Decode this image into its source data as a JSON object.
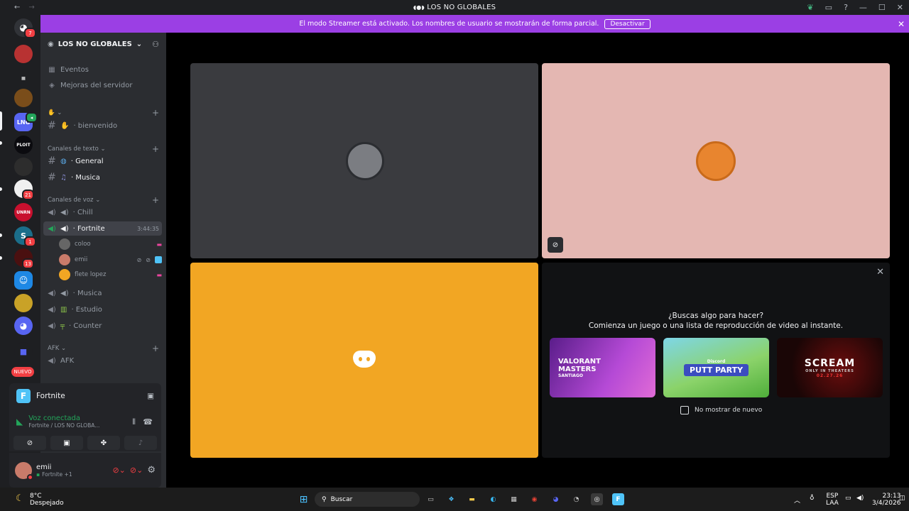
{
  "window": {
    "title": "LOS NO GLOBALES"
  },
  "guilds": {
    "badges": [
      "7",
      "21",
      "1",
      "13"
    ],
    "labels": {
      "lng": "LNG",
      "ploit": "PLOIT",
      "unrn": "UNRN",
      "s": "S"
    },
    "new_label": "NUEVO"
  },
  "banner": {
    "text": "El modo Streamer está activado. Los nombres de usuario se mostrarán de forma parcial.",
    "button": "Desactivar"
  },
  "server": {
    "name": "LOS NO GLOBALES"
  },
  "sidebar": {
    "events": "Eventos",
    "boosts": "Mejoras del servidor",
    "welcome_channel": "· bienvenido",
    "text_category": "Canales de texto",
    "text_channels": [
      "· General",
      "· Musica"
    ],
    "voice_category": "Canales de voz",
    "voice_channels": [
      "· Chill",
      "· Fortnite",
      "· Musica",
      "· Estudio",
      "· Counter"
    ],
    "fortnite_timer": "3:44:35",
    "voice_users": [
      "coloo",
      "emii",
      "flete lopez"
    ],
    "afk_category": "AFK",
    "afk_channel": "AFK"
  },
  "activity": {
    "game": "Fortnite"
  },
  "voice_status": {
    "title": "Voz conectada",
    "subtitle": "Fortnite / LOS NO GLOBA..."
  },
  "user_panel": {
    "name": "emii",
    "status": "Fortnite +1"
  },
  "promo": {
    "heading": "¿Buscas algo para hacer?",
    "subheading": "Comienza un juego o una lista de reproducción de video al instante.",
    "cards": [
      {
        "line1": "VALORANT",
        "line2": "MASTERS",
        "line3": "SANTIAGO"
      },
      {
        "line1": "Discord",
        "line2": "PUTT PARTY"
      },
      {
        "line1": "SCREAM",
        "line2": "ONLY IN THEATERS",
        "line3": "02.27.26"
      }
    ],
    "checkbox_label": "No mostrar de nuevo"
  },
  "taskbar": {
    "temperature": "8°C",
    "weather": "Despejado",
    "search": "Buscar",
    "lang1": "ESP",
    "lang2": "LAA",
    "time": "23:13",
    "date": "3/4/2026"
  },
  "colors": {
    "banner": "#9b3fe4",
    "sidebar": "#2b2d31",
    "tile_gray": "#3a3b3f",
    "tile_pink": "#e4b7b2",
    "tile_orange": "#f2a623",
    "voice_green": "#23a55a"
  }
}
